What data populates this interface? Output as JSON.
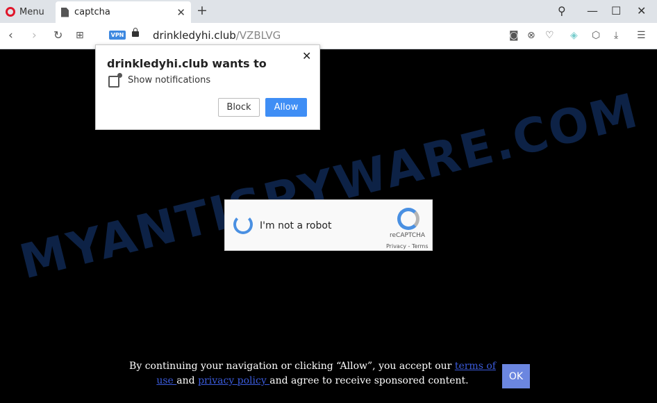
{
  "browser": {
    "menu_label": "Menu",
    "tab_title": "captcha",
    "vpn_badge": "VPN",
    "url_host": "drinkledyhi.club",
    "url_path": "/VZBLVG"
  },
  "notification_prompt": {
    "title": "drinkledyhi.club wants to",
    "permission": "Show notifications",
    "block_label": "Block",
    "allow_label": "Allow"
  },
  "captcha": {
    "label": "I'm not a robot",
    "brand": "reCAPTCHA",
    "links": "Privacy - Terms"
  },
  "footer": {
    "text_before": "By continuing your navigation or clicking “Allow”, you accept our ",
    "terms_link": "terms of use ",
    "text_middle": "and ",
    "privacy_link": "privacy policy ",
    "text_after": "and agree to receive sponsored content.",
    "ok_label": "OK"
  },
  "watermark": "MYANTISPYWARE.COM",
  "colors": {
    "allow_button": "#3f8ef5",
    "ok_button": "#6b86e0",
    "link": "#3b5bdb",
    "opera_red": "#e0162b"
  }
}
